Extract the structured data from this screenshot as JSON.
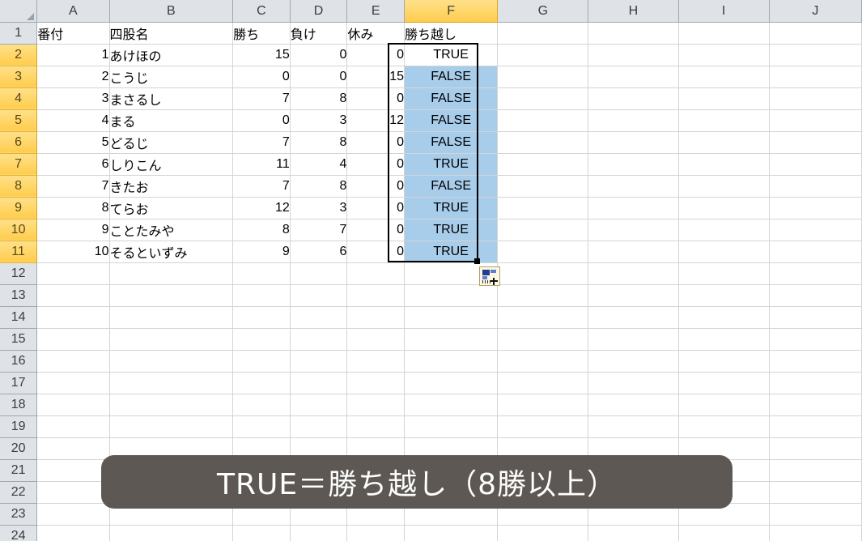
{
  "app": {
    "type": "spreadsheet",
    "corner_icon": "select-all-triangle-icon"
  },
  "columns": {
    "headers": [
      "A",
      "B",
      "C",
      "D",
      "E",
      "F",
      "G",
      "H",
      "I",
      "J"
    ],
    "selected": "F",
    "widths": [
      86,
      147,
      68,
      68,
      68,
      111,
      108,
      107,
      108,
      110
    ]
  },
  "rows": {
    "numbers": [
      "1",
      "2",
      "3",
      "4",
      "5",
      "6",
      "7",
      "8",
      "9",
      "10",
      "11",
      "12",
      "13",
      "14",
      "15",
      "16",
      "17",
      "18",
      "19",
      "20",
      "21",
      "22",
      "23",
      "24"
    ],
    "selected_range": [
      "2",
      "3",
      "4",
      "5",
      "6",
      "7",
      "8",
      "9",
      "10",
      "11"
    ]
  },
  "table": {
    "header_row": {
      "A": "番付",
      "B": "四股名",
      "C": "勝ち",
      "D": "負け",
      "E": "休み",
      "F": "勝ち越し"
    },
    "data_rows": [
      {
        "rank": "1",
        "name": "あけほの",
        "wins": "15",
        "losses": "0",
        "rest": "0",
        "kachikoshi": "TRUE"
      },
      {
        "rank": "2",
        "name": "こうじ",
        "wins": "0",
        "losses": "0",
        "rest": "15",
        "kachikoshi": "FALSE"
      },
      {
        "rank": "3",
        "name": "まさるし",
        "wins": "7",
        "losses": "8",
        "rest": "0",
        "kachikoshi": "FALSE"
      },
      {
        "rank": "4",
        "name": "まる",
        "wins": "0",
        "losses": "3",
        "rest": "12",
        "kachikoshi": "FALSE"
      },
      {
        "rank": "5",
        "name": "どるじ",
        "wins": "7",
        "losses": "8",
        "rest": "0",
        "kachikoshi": "FALSE"
      },
      {
        "rank": "6",
        "name": "しりこん",
        "wins": "11",
        "losses": "4",
        "rest": "0",
        "kachikoshi": "TRUE"
      },
      {
        "rank": "7",
        "name": "きたお",
        "wins": "7",
        "losses": "8",
        "rest": "0",
        "kachikoshi": "FALSE"
      },
      {
        "rank": "8",
        "name": "てらお",
        "wins": "12",
        "losses": "3",
        "rest": "0",
        "kachikoshi": "TRUE"
      },
      {
        "rank": "9",
        "name": "ことたみや",
        "wins": "8",
        "losses": "7",
        "rest": "0",
        "kachikoshi": "TRUE"
      },
      {
        "rank": "10",
        "name": "そるといずみ",
        "wins": "9",
        "losses": "6",
        "rest": "0",
        "kachikoshi": "TRUE"
      }
    ]
  },
  "selection": {
    "range": "F2:F11",
    "active_cell": "F2",
    "fill_handle": "fill-handle",
    "smart_tag": "auto-fill-options-icon"
  },
  "caption": {
    "text": "TRUE＝勝ち越し（8勝以上）"
  },
  "colors": {
    "header_bg": "#dfe3e8",
    "header_selected_bg": "#ffd966",
    "selection_blue": "#a8cdeb",
    "gridline": "#d4d4d4",
    "caption_bg": "#5d5853",
    "selection_border": "#000000"
  }
}
